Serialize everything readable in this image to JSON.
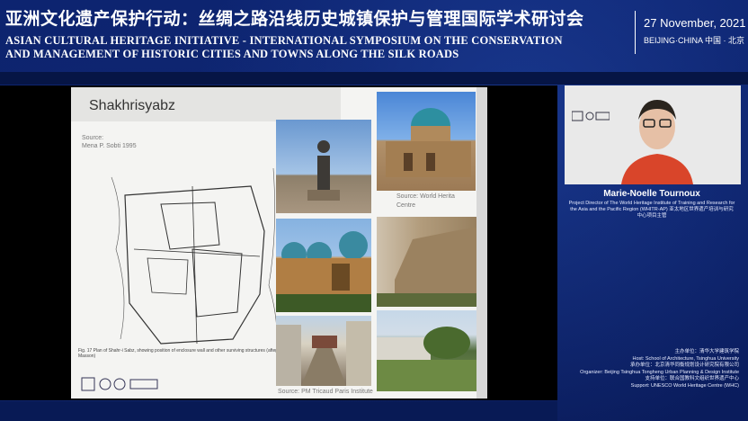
{
  "header": {
    "title_cn": "亚洲文化遗产保护行动：丝绸之路沿线历史城镇保护与管理国际学术研讨会",
    "title_en_line1": "ASIAN CULTURAL HERITAGE INITIATIVE - INTERNATIONAL SYMPOSIUM ON THE CONSERVATION",
    "title_en_line2": "AND MANAGEMENT OF HISTORIC CITIES AND TOWNS ALONG THE SILK ROADS",
    "date": "27 November, 2021",
    "location": "BEIJING·CHINA  中国 · 北京"
  },
  "slide": {
    "title": "Shakhrisyabz",
    "source_label": "Source:",
    "source_text": "Mena P. Sobti 1995",
    "map_caption": "Fig. 17  Plan of Shahr-i Sabz, showing position of enclosure wall and other surviving structures (after Masson)",
    "photo_source_wh_1": "Source: World Herita",
    "photo_source_wh_2": "Centre",
    "photo_source_pm": "Source: PM Tricaud Paris Institute"
  },
  "speaker": {
    "name": "Marie-Noelle Tournoux",
    "role": "Project Director of The World Heritage Institute of Training and Research for the Asia and the Pacific Region (WHITR-AP) 亚太地区世界遗产培训与研究中心项目主管"
  },
  "sponsors": {
    "line1": "主办单位：清华大学建筑学院",
    "line2": "Host: School of Architecture, Tsinghua University",
    "line3": "承办单位：北京清华同衡规划设计研究院有限公司",
    "line4": "Organizer: Beijing Tsinghua Tongheng Urban Planning & Design Institute",
    "line5": "支持单位：联合国教科文组织世界遗产中心",
    "line6": "Support: UNESCO World Heritage Centre (WHC)"
  },
  "colors": {
    "background": "#0a1f63",
    "accent": "#ffffff"
  }
}
